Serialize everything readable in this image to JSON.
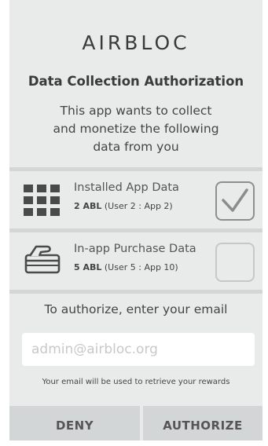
{
  "brand": "AIRBLOC",
  "title": "Data Collection Authorization",
  "description_lines": [
    "This app wants to collect",
    "and monetize the following",
    "data from you"
  ],
  "items": [
    {
      "name": "Installed App Data",
      "amount": "2 ABL",
      "detail": "(User 2 : App 2)",
      "checked": true,
      "icon": "app-grid-icon"
    },
    {
      "name": "In-app Purchase Data",
      "amount": "5 ABL",
      "detail": "(User 5 : App 10)",
      "checked": false,
      "icon": "card-payment-icon"
    }
  ],
  "email": {
    "prompt": "To authorize, enter your email",
    "placeholder": "admin@airbloc.org",
    "value": "",
    "hint": "Your email will be used to retrieve your rewards"
  },
  "buttons": {
    "deny": "DENY",
    "authorize": "AUTHORIZE"
  },
  "colors": {
    "background": "#e9ebeb",
    "divider": "#d3d6d6",
    "text": "#3d3d3d"
  }
}
